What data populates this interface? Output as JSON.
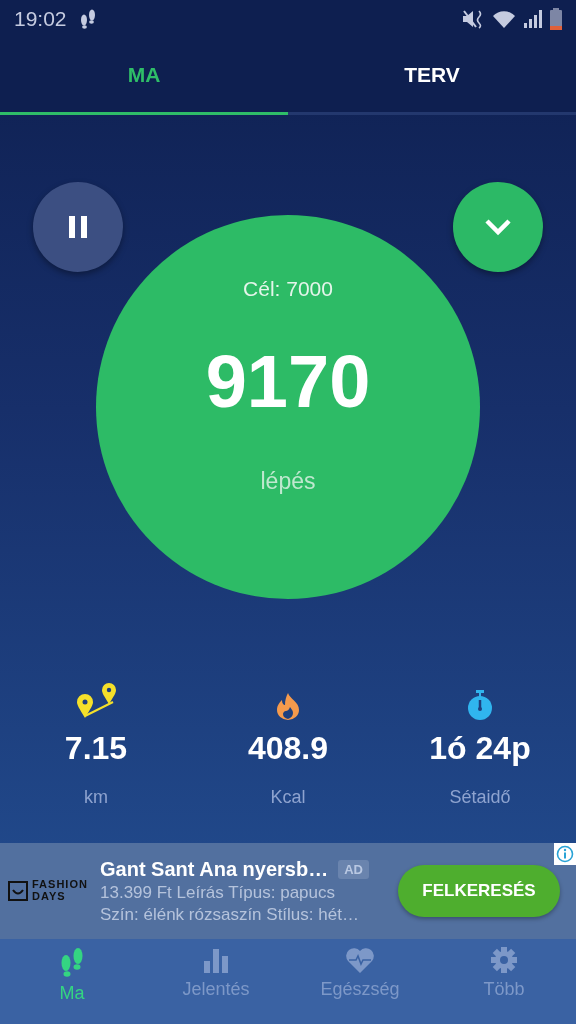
{
  "status_bar": {
    "time": "19:02"
  },
  "tabs": [
    {
      "label": "MA",
      "selected": true
    },
    {
      "label": "TERV",
      "selected": false
    }
  ],
  "counter": {
    "goal": "Cél: 7000",
    "steps": "9170",
    "unit": "lépés"
  },
  "stats": [
    {
      "kind": "distance",
      "value": "7.15",
      "label": "km"
    },
    {
      "kind": "calories",
      "value": "408.9",
      "label": "Kcal"
    },
    {
      "kind": "time",
      "value": "1ó 24p",
      "label": "Sétaidő"
    }
  ],
  "ad": {
    "brand": "FASHION DAYS",
    "title": "Gant Sant Ana nyersb…",
    "badge": "AD",
    "line_1": "13.399 Ft Leírás Típus: papucs",
    "line_2": "Szín: élénk rózsaszín Stílus: hét…",
    "button": "FELKERESÉS"
  },
  "nav": [
    {
      "kind": "steps",
      "label": "Ma",
      "selected": true
    },
    {
      "kind": "report",
      "label": "Jelentés",
      "selected": false
    },
    {
      "kind": "health",
      "label": "Egészség",
      "selected": false
    },
    {
      "kind": "more",
      "label": "Több",
      "selected": false
    }
  ]
}
